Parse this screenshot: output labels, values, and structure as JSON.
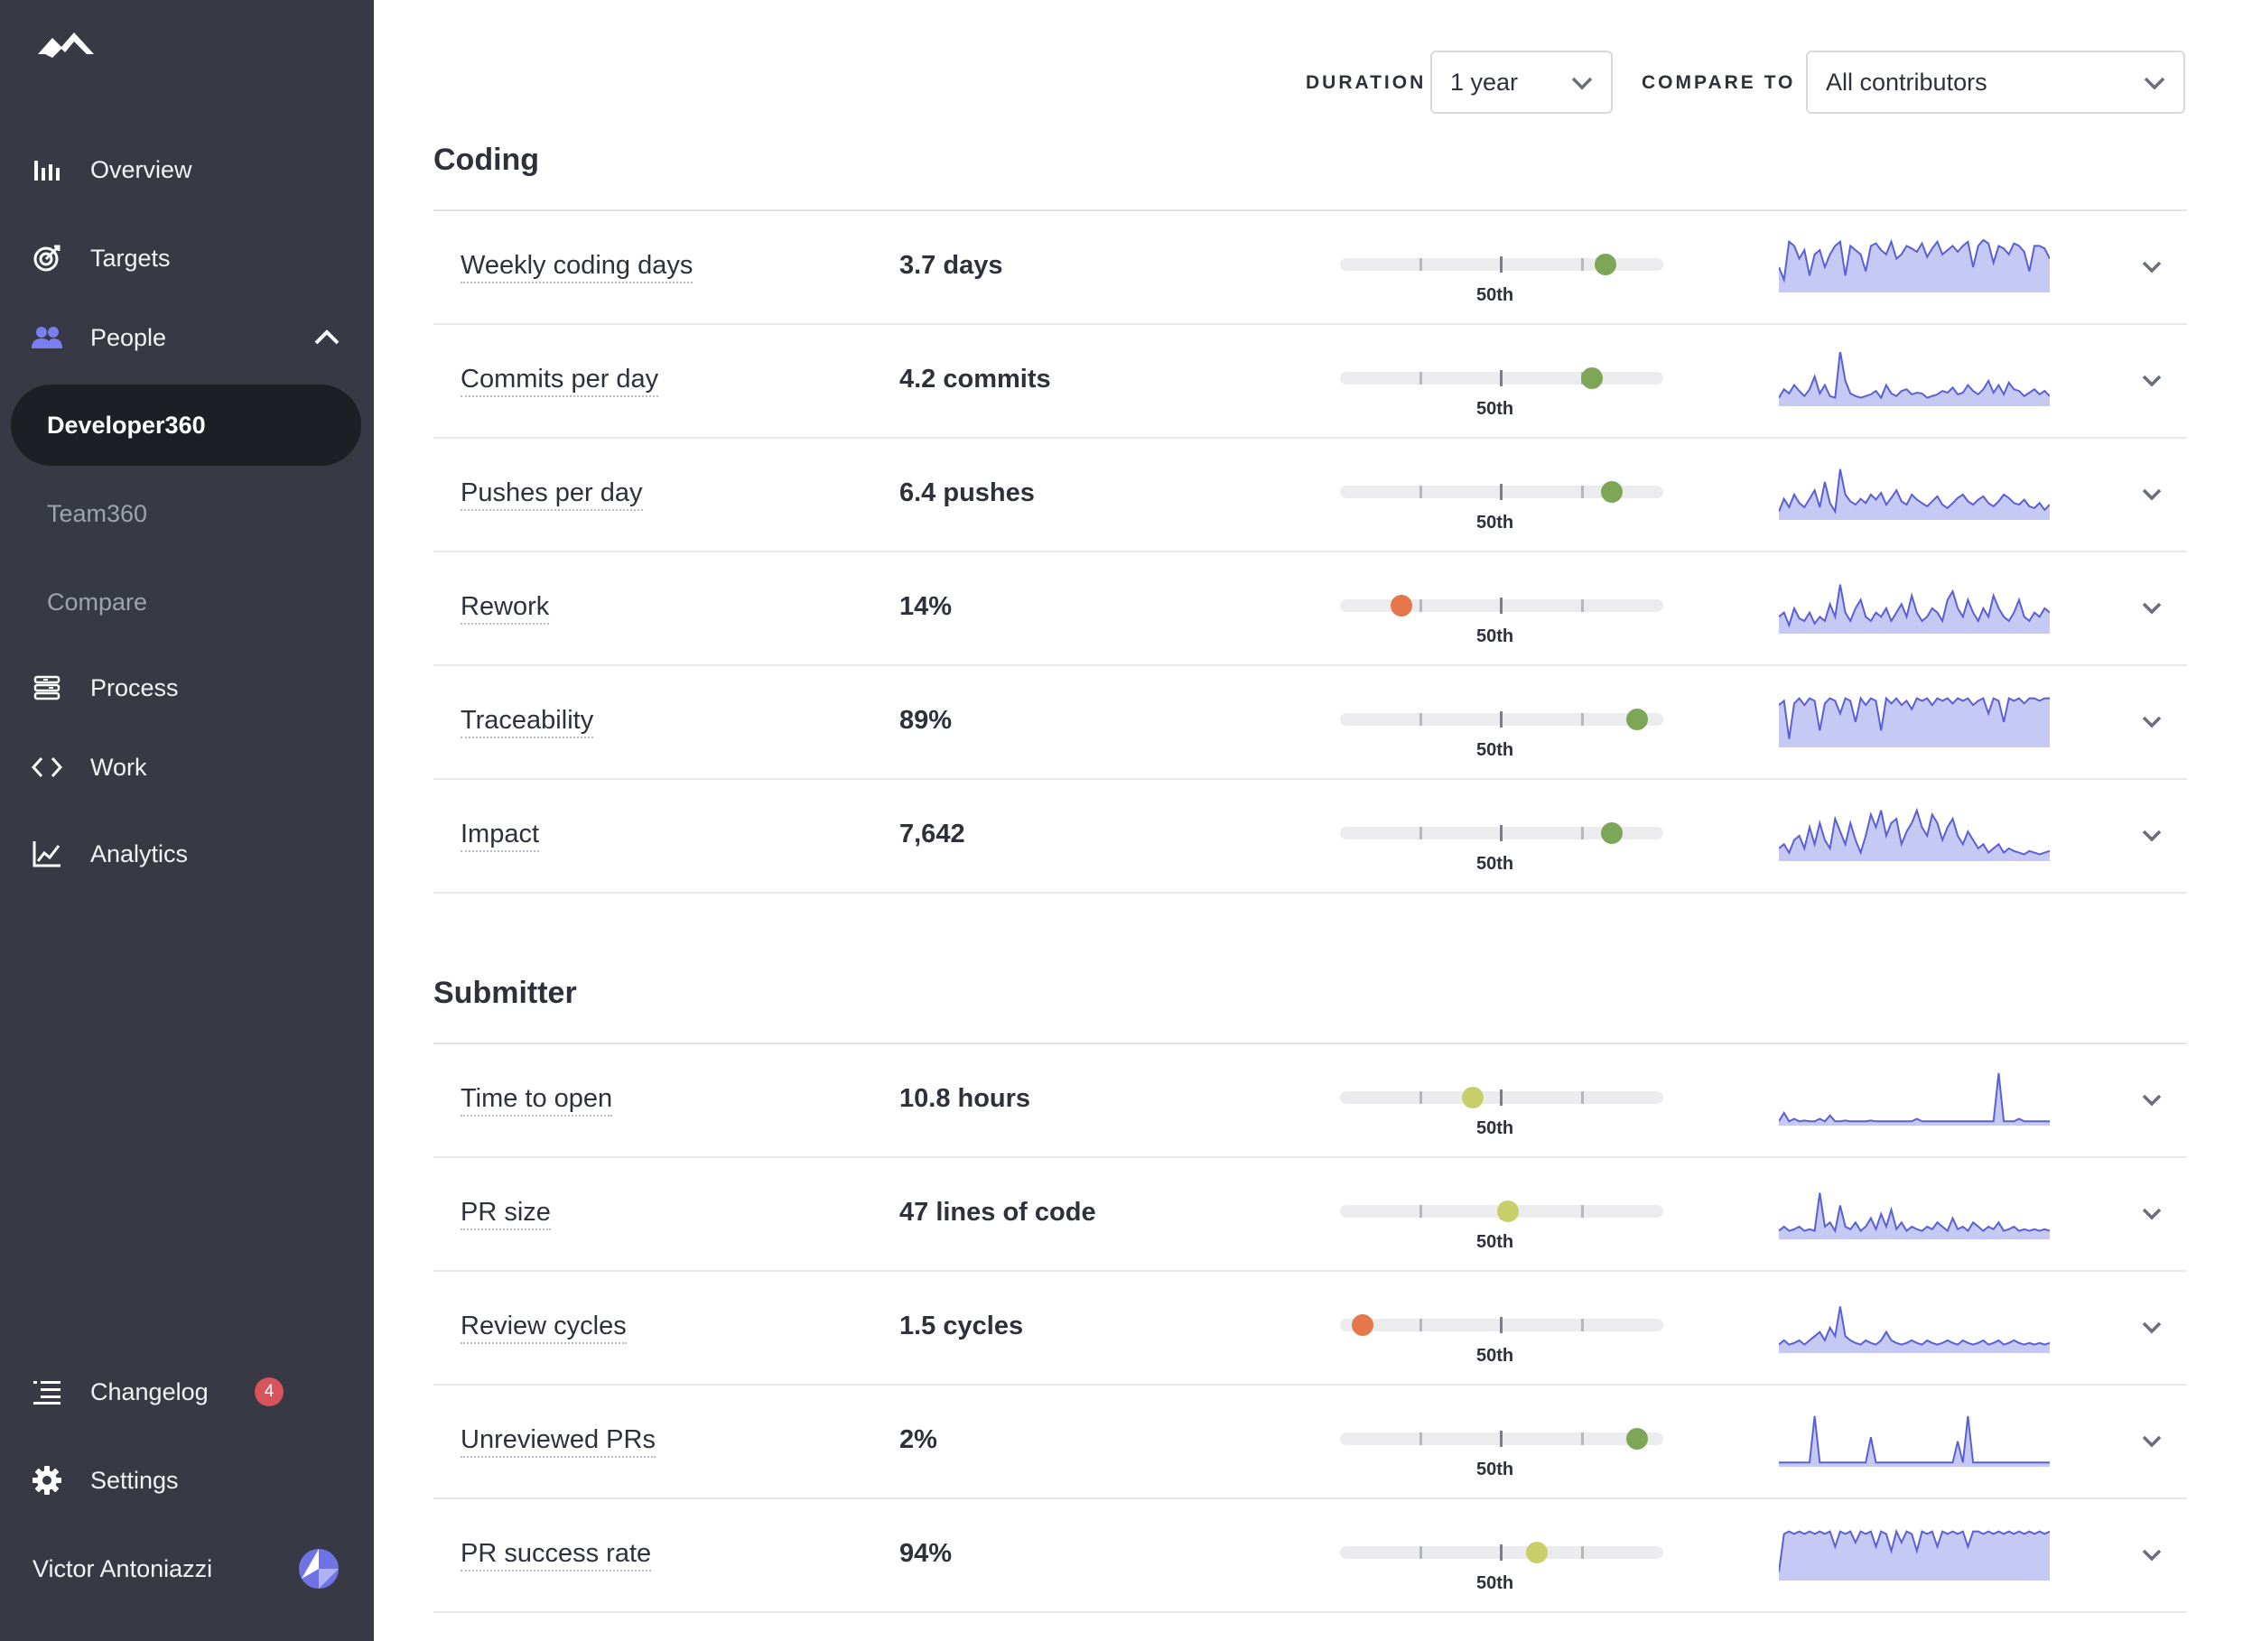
{
  "sidebar": {
    "nav": [
      {
        "key": "overview",
        "label": "Overview",
        "icon": "bar-chart-icon"
      },
      {
        "key": "targets",
        "label": "Targets",
        "icon": "target-icon"
      },
      {
        "key": "people",
        "label": "People",
        "icon": "people-icon",
        "expanded": true
      }
    ],
    "people_sub": [
      {
        "label": "Developer360",
        "active": true
      },
      {
        "label": "Team360",
        "active": false
      },
      {
        "label": "Compare",
        "active": false
      }
    ],
    "nav2": [
      {
        "key": "process",
        "label": "Process",
        "icon": "process-icon"
      },
      {
        "key": "work",
        "label": "Work",
        "icon": "code-icon"
      },
      {
        "key": "analytics",
        "label": "Analytics",
        "icon": "line-chart-icon"
      }
    ],
    "bottom": {
      "changelog": {
        "label": "Changelog",
        "badge": "4",
        "icon": "list-icon"
      },
      "settings": {
        "label": "Settings",
        "icon": "gear-icon"
      },
      "user": {
        "name": "Victor Antoniazzi",
        "icon": "avatar-icon"
      }
    }
  },
  "filters": {
    "duration_label": "DURATION",
    "duration_value": "1 year",
    "compare_label": "COMPARE TO",
    "compare_value": "All contributors"
  },
  "sections": [
    {
      "title": "Coding",
      "rows": [
        {
          "name": "Weekly coding days",
          "value": "3.7 days",
          "percentile": 82,
          "status": "green",
          "spark": [
            30,
            15,
            60,
            55,
            40,
            50,
            20,
            45,
            50,
            30,
            45,
            55,
            60,
            20,
            55,
            50,
            45,
            25,
            55,
            58,
            50,
            45,
            60,
            40,
            45,
            55,
            52,
            48,
            58,
            42,
            52,
            60,
            45,
            50,
            55,
            48,
            55,
            60,
            30,
            55,
            62,
            58,
            35,
            55,
            52,
            45,
            58,
            55,
            48,
            25,
            55,
            55,
            52,
            40
          ]
        },
        {
          "name": "Commits per day",
          "value": "4.2 commits",
          "percentile": 78,
          "status": "green",
          "spark": [
            10,
            20,
            15,
            25,
            18,
            12,
            20,
            35,
            15,
            25,
            12,
            10,
            65,
            30,
            15,
            12,
            10,
            12,
            14,
            18,
            10,
            25,
            15,
            12,
            18,
            20,
            14,
            16,
            15,
            10,
            12,
            14,
            18,
            16,
            22,
            14,
            16,
            25,
            18,
            14,
            20,
            30,
            16,
            25,
            14,
            28,
            20,
            18,
            12,
            16,
            20,
            14,
            18,
            12
          ]
        },
        {
          "name": "Pushes per day",
          "value": "6.4 pushes",
          "percentile": 84,
          "status": "green",
          "spark": [
            10,
            25,
            15,
            30,
            20,
            15,
            25,
            35,
            15,
            45,
            20,
            10,
            60,
            30,
            22,
            18,
            25,
            20,
            30,
            24,
            32,
            18,
            26,
            35,
            22,
            18,
            30,
            24,
            20,
            16,
            22,
            28,
            18,
            14,
            20,
            26,
            30,
            22,
            18,
            24,
            28,
            20,
            16,
            22,
            30,
            26,
            20,
            18,
            24,
            16,
            14,
            20,
            12,
            18
          ]
        },
        {
          "name": "Rework",
          "value": "14%",
          "percentile": 19,
          "status": "orange",
          "spark": [
            20,
            25,
            10,
            30,
            18,
            15,
            25,
            12,
            20,
            15,
            35,
            20,
            58,
            25,
            15,
            30,
            40,
            20,
            15,
            25,
            20,
            30,
            15,
            25,
            35,
            20,
            45,
            25,
            15,
            20,
            30,
            25,
            15,
            40,
            50,
            30,
            20,
            40,
            25,
            15,
            30,
            20,
            45,
            30,
            20,
            15,
            25,
            40,
            20,
            15,
            25,
            20,
            30,
            25
          ]
        },
        {
          "name": "Traceability",
          "value": "89%",
          "percentile": 92,
          "status": "green",
          "spark": [
            50,
            55,
            10,
            52,
            58,
            50,
            58,
            55,
            20,
            52,
            58,
            55,
            40,
            58,
            55,
            30,
            58,
            50,
            58,
            55,
            20,
            58,
            52,
            58,
            50,
            55,
            45,
            58,
            55,
            58,
            50,
            58,
            55,
            58,
            52,
            58,
            55,
            58,
            50,
            55,
            58,
            40,
            58,
            55,
            30,
            58,
            55,
            58,
            52,
            58,
            58,
            55,
            58,
            58
          ]
        },
        {
          "name": "Impact",
          "value": "7,642",
          "percentile": 84,
          "status": "green",
          "spark": [
            15,
            20,
            10,
            25,
            30,
            15,
            40,
            20,
            45,
            25,
            15,
            50,
            35,
            20,
            45,
            25,
            10,
            30,
            55,
            40,
            60,
            30,
            45,
            50,
            20,
            35,
            45,
            60,
            40,
            30,
            55,
            45,
            25,
            40,
            50,
            30,
            20,
            35,
            25,
            15,
            20,
            10,
            15,
            20,
            10,
            15,
            12,
            10,
            8,
            12,
            10,
            8,
            10,
            12
          ]
        }
      ]
    },
    {
      "title": "Submitter",
      "rows": [
        {
          "name": "Time to open",
          "value": "10.8 hours",
          "percentile": 41,
          "status": "yellow",
          "spark": [
            5,
            15,
            5,
            8,
            5,
            6,
            5,
            5,
            8,
            5,
            12,
            5,
            5,
            6,
            5,
            5,
            5,
            5,
            6,
            5,
            5,
            5,
            5,
            5,
            5,
            5,
            5,
            8,
            5,
            5,
            5,
            5,
            5,
            5,
            5,
            5,
            5,
            5,
            5,
            5,
            5,
            5,
            5,
            62,
            5,
            5,
            5,
            8,
            5,
            5,
            5,
            5,
            5,
            5
          ]
        },
        {
          "name": "PR size",
          "value": "47 lines of code",
          "percentile": 52,
          "status": "yellow",
          "spark": [
            10,
            15,
            10,
            12,
            15,
            10,
            12,
            10,
            55,
            15,
            20,
            10,
            40,
            15,
            12,
            20,
            10,
            15,
            25,
            12,
            30,
            15,
            35,
            12,
            20,
            10,
            15,
            12,
            10,
            15,
            12,
            20,
            15,
            10,
            25,
            12,
            15,
            10,
            20,
            15,
            10,
            15,
            12,
            20,
            10,
            12,
            15,
            10,
            12,
            10,
            12,
            10,
            12,
            10
          ]
        },
        {
          "name": "Review cycles",
          "value": "1.5 cycles",
          "percentile": 7,
          "status": "orange",
          "spark": [
            10,
            15,
            10,
            12,
            15,
            10,
            15,
            20,
            25,
            15,
            30,
            20,
            55,
            20,
            15,
            12,
            10,
            15,
            12,
            10,
            15,
            25,
            15,
            12,
            10,
            12,
            15,
            12,
            10,
            15,
            12,
            10,
            12,
            15,
            12,
            10,
            15,
            12,
            10,
            12,
            15,
            10,
            12,
            15,
            10,
            12,
            15,
            12,
            10,
            12,
            10,
            12,
            10,
            12
          ]
        },
        {
          "name": "Unreviewed PRs",
          "value": "2%",
          "percentile": 92,
          "status": "green",
          "spark": [
            5,
            5,
            5,
            5,
            5,
            5,
            5,
            60,
            5,
            5,
            5,
            5,
            5,
            5,
            5,
            5,
            5,
            5,
            35,
            5,
            5,
            5,
            5,
            5,
            5,
            5,
            5,
            5,
            5,
            5,
            5,
            5,
            5,
            5,
            5,
            30,
            5,
            60,
            5,
            5,
            5,
            5,
            5,
            5,
            5,
            5,
            5,
            5,
            5,
            5,
            5,
            5,
            5,
            5
          ]
        },
        {
          "name": "PR success rate",
          "value": "94%",
          "percentile": 61,
          "status": "yellow",
          "spark": [
            10,
            55,
            58,
            55,
            58,
            55,
            58,
            55,
            58,
            55,
            58,
            40,
            58,
            55,
            58,
            45,
            58,
            55,
            58,
            40,
            58,
            55,
            35,
            58,
            45,
            58,
            55,
            35,
            58,
            55,
            58,
            40,
            58,
            55,
            58,
            55,
            58,
            40,
            58,
            58,
            55,
            58,
            55,
            58,
            55,
            58,
            55,
            58,
            55,
            58,
            55,
            58,
            55,
            58
          ]
        }
      ]
    }
  ],
  "percentile_label": "50th",
  "colors": {
    "green": "#7da756",
    "orange": "#e4784a",
    "yellow": "#c8cf6a",
    "spark_line": "#5a5fd6",
    "spark_fill": "#c7c9f5",
    "sidebar_bg": "#373a44"
  }
}
